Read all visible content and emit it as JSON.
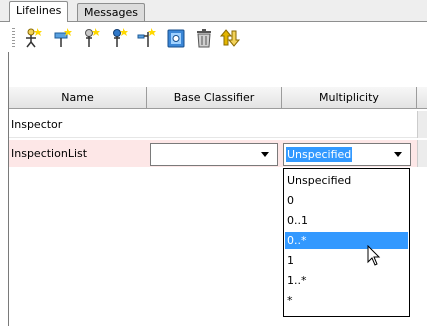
{
  "tabs": [
    {
      "label": "Lifelines",
      "active": true
    },
    {
      "label": "Messages",
      "active": false
    }
  ],
  "toolbar": {
    "icons": [
      "add-lifeline-icon",
      "add-lifeline-property-icon",
      "add-lifeline-attribute-icon",
      "add-lifeline-part-icon",
      "add-lifeline-port-icon",
      "open-specification-icon",
      "delete-icon",
      "sort-icon"
    ]
  },
  "columns": [
    "Name",
    "Base Classifier",
    "Multiplicity"
  ],
  "rows": [
    {
      "name": "Inspector",
      "base_classifier": "",
      "multiplicity": ""
    },
    {
      "name": "InspectionList",
      "base_classifier": "",
      "multiplicity": "Unspecified"
    }
  ],
  "multiplicity_options": [
    "Unspecified",
    "0",
    "0..1",
    "0..*",
    "1",
    "1..*",
    "*"
  ],
  "highlighted_option_index": 3,
  "colors": {
    "selection": "#3399ff",
    "error_row": "#fde7e7"
  }
}
